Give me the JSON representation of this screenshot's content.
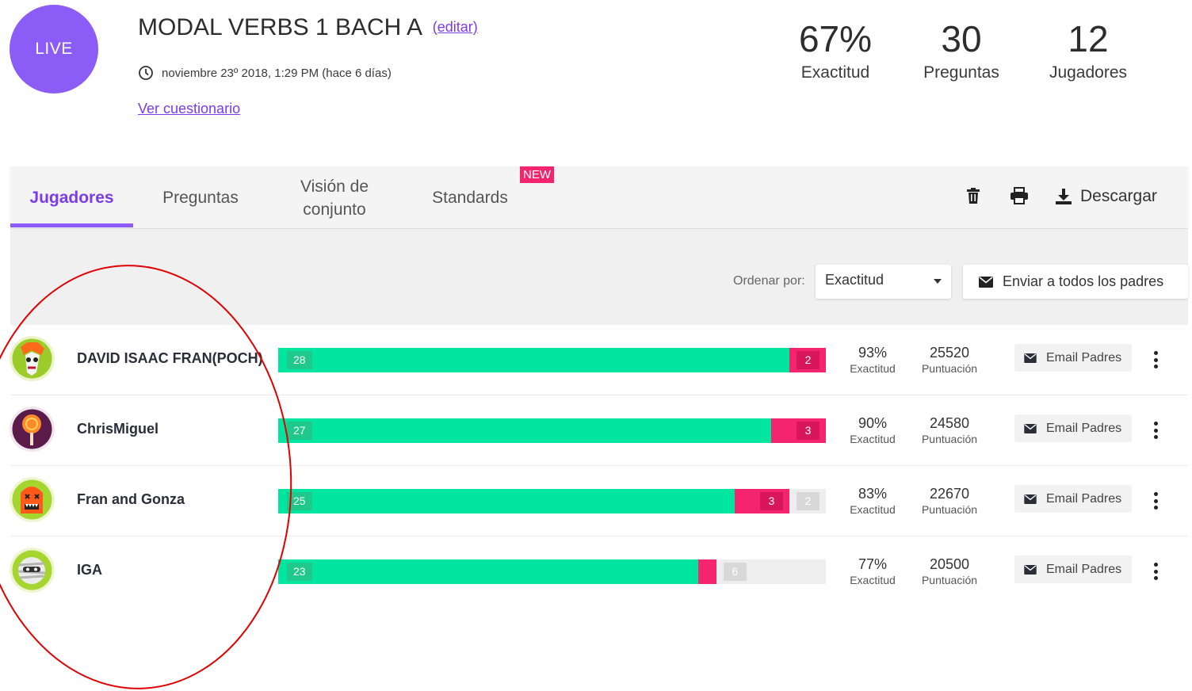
{
  "header": {
    "live_label": "LIVE",
    "title": "MODAL VERBS 1 BACH A",
    "edit_label": "(editar)",
    "date": "noviembre 23º 2018, 1:29 PM (hace 6 días)",
    "view_quiz_label": "Ver cuestionario",
    "stats": [
      {
        "value": "67%",
        "label": "Exactitud"
      },
      {
        "value": "30",
        "label": "Preguntas"
      },
      {
        "value": "12",
        "label": "Jugadores"
      }
    ]
  },
  "tabs": {
    "players": "Jugadores",
    "questions": "Preguntas",
    "overview": "Visión de conjunto",
    "standards": "Standards",
    "new_badge": "NEW",
    "download": "Descargar"
  },
  "sort": {
    "label": "Ordenar por:",
    "selected": "Exactitud",
    "send_all": "Enviar a todos los padres"
  },
  "players": [
    {
      "name": "DAVID ISAAC FRAN(POCH)",
      "correct": 28,
      "wrong": 2,
      "skipped": 0,
      "accuracy": "93%",
      "accuracy_label": "Exactitud",
      "score": "25520",
      "score_label": "Puntuación",
      "email_label": "Email Padres"
    },
    {
      "name": "ChrisMiguel",
      "correct": 27,
      "wrong": 3,
      "skipped": 0,
      "accuracy": "90%",
      "accuracy_label": "Exactitud",
      "score": "24580",
      "score_label": "Puntuación",
      "email_label": "Email Padres"
    },
    {
      "name": "Fran and Gonza",
      "correct": 25,
      "wrong": 3,
      "skipped": 2,
      "accuracy": "83%",
      "accuracy_label": "Exactitud",
      "score": "22670",
      "score_label": "Puntuación",
      "email_label": "Email Padres"
    },
    {
      "name": "IGA",
      "correct": 23,
      "wrong": 1,
      "skipped": 6,
      "accuracy": "77%",
      "accuracy_label": "Exactitud",
      "score": "20500",
      "score_label": "Puntuación",
      "email_label": "Email Padres"
    }
  ],
  "colors": {
    "accent": "#8b5cf6",
    "correct": "#00e5a0",
    "wrong": "#f4256d",
    "annotation": "#e00000"
  },
  "icons": [
    "clock-icon",
    "trash-icon",
    "printer-icon",
    "download-icon",
    "envelope-icon",
    "kebab-menu-icon",
    "chevron-down-icon"
  ]
}
